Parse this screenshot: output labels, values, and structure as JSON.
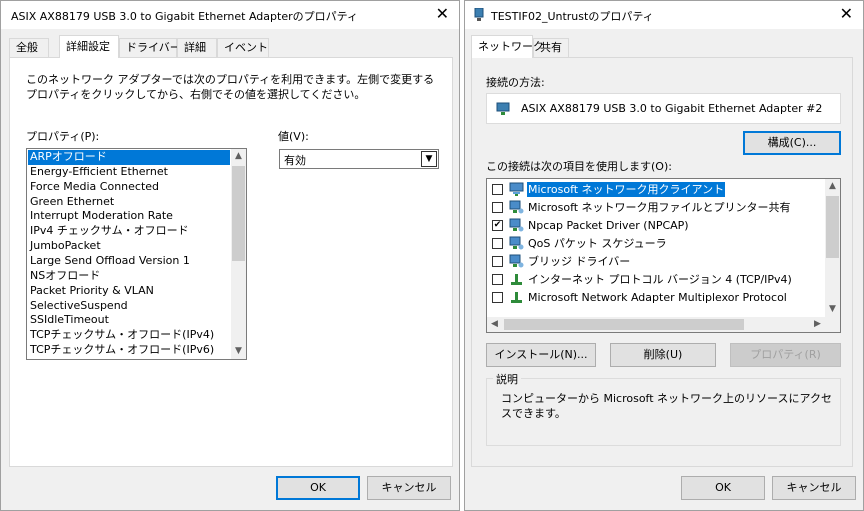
{
  "left_dialog": {
    "title": "ASIX AX88179 USB 3.0 to Gigabit Ethernet Adapterのプロパティ",
    "tabs": [
      "全般",
      "詳細設定",
      "ドライバー",
      "詳細",
      "イベント"
    ],
    "description": "このネットワーク アダプターでは次のプロパティを利用できます。左側で変更するプロパティをクリックしてから、右側でその値を選択してください。",
    "property_label": "プロパティ(P):",
    "value_label": "値(V):",
    "properties": [
      "ARPオフロード",
      "Energy-Efficient Ethernet",
      "Force Media Connected",
      "Green Ethernet",
      "Interrupt Moderation Rate",
      "IPv4 チェックサム・オフロード",
      "JumboPacket",
      "Large Send Offload Version 1",
      "NSオフロード",
      "Packet Priority & VLAN",
      "SelectiveSuspend",
      "SSIdleTimeout",
      "TCPチェックサム・オフロード(IPv4)",
      "TCPチェックサム・オフロード(IPv6)"
    ],
    "selected_property_index": 0,
    "value_selected": "有効",
    "ok_label": "OK",
    "cancel_label": "キャンセル"
  },
  "right_dialog": {
    "title": "TESTIF02_Untrustのプロパティ",
    "tabs": [
      "ネットワーク",
      "共有"
    ],
    "connect_using_label": "接続の方法:",
    "adapter_name": "ASIX AX88179 USB 3.0 to Gigabit Ethernet Adapter #2",
    "configure_label": "構成(C)...",
    "items_label": "この接続は次の項目を使用します(O):",
    "components": [
      {
        "label": "Microsoft ネットワーク用クライアント",
        "checked": false,
        "icon": "network-client-icon"
      },
      {
        "label": "Microsoft ネットワーク用ファイルとプリンター共有",
        "checked": false,
        "icon": "network-service-icon"
      },
      {
        "label": "Npcap Packet Driver (NPCAP)",
        "checked": true,
        "icon": "network-service-icon"
      },
      {
        "label": "QoS パケット スケジューラ",
        "checked": false,
        "icon": "network-service-icon"
      },
      {
        "label": "ブリッジ ドライバー",
        "checked": false,
        "icon": "network-service-icon"
      },
      {
        "label": "インターネット プロトコル バージョン 4 (TCP/IPv4)",
        "checked": false,
        "icon": "protocol-icon"
      },
      {
        "label": "Microsoft Network Adapter Multiplexor Protocol",
        "checked": false,
        "icon": "protocol-icon"
      }
    ],
    "selected_component_index": 0,
    "install_label": "インストール(N)...",
    "uninstall_label": "削除(U)",
    "properties_label": "プロパティ(R)",
    "description_group_label": "説明",
    "description_text": "コンピューターから Microsoft ネットワーク上のリソースにアクセスできます。",
    "ok_label": "OK",
    "cancel_label": "キャンセル"
  },
  "colors": {
    "selection": "#0078d7",
    "dialog_bg": "#f0f0f0",
    "default_button_border": "#0078d7"
  }
}
